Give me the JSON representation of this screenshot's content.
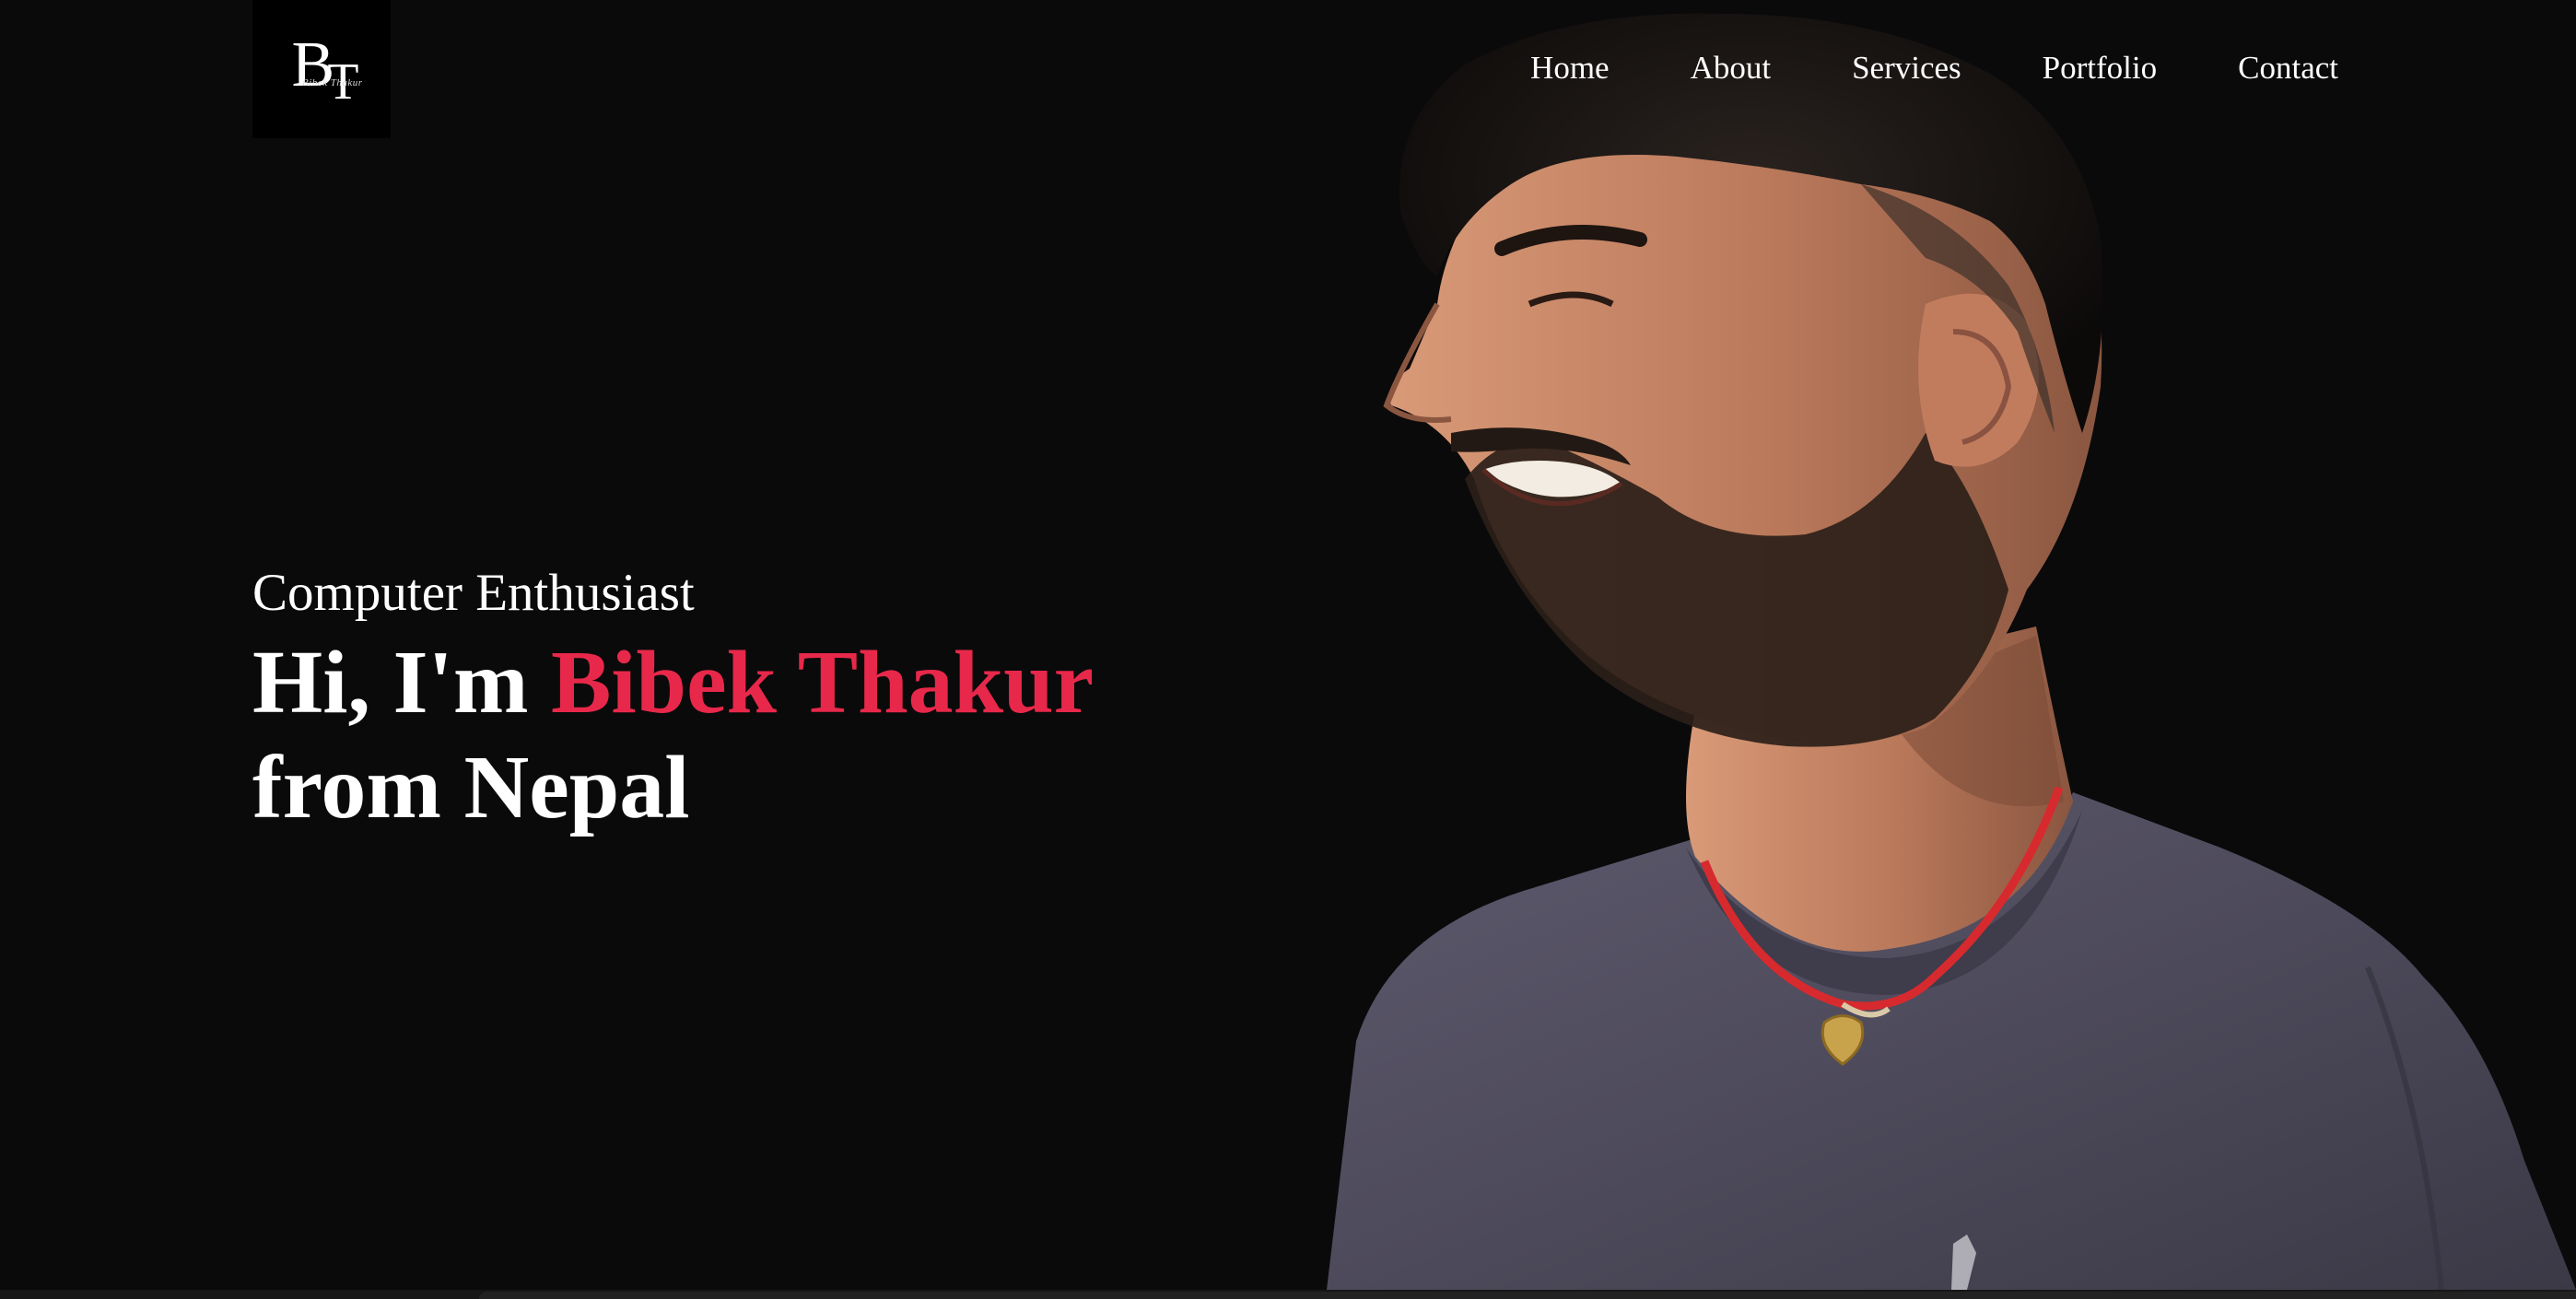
{
  "header": {
    "logo": {
      "monogram_b": "B",
      "monogram_t": "T",
      "signature": "Bibek Thakur"
    },
    "nav": [
      {
        "label": "Home"
      },
      {
        "label": "About"
      },
      {
        "label": "Services"
      },
      {
        "label": "Portfolio"
      },
      {
        "label": "Contact"
      }
    ]
  },
  "hero": {
    "subtitle": "Computer Enthusiast",
    "greeting": "Hi, I'm",
    "name": "Bibek Thakur",
    "line2": "from Nepal",
    "portrait_icon": "person-portrait"
  },
  "colors": {
    "background": "#0a0a0b",
    "accent": "#e8284a",
    "text": "#ffffff"
  }
}
